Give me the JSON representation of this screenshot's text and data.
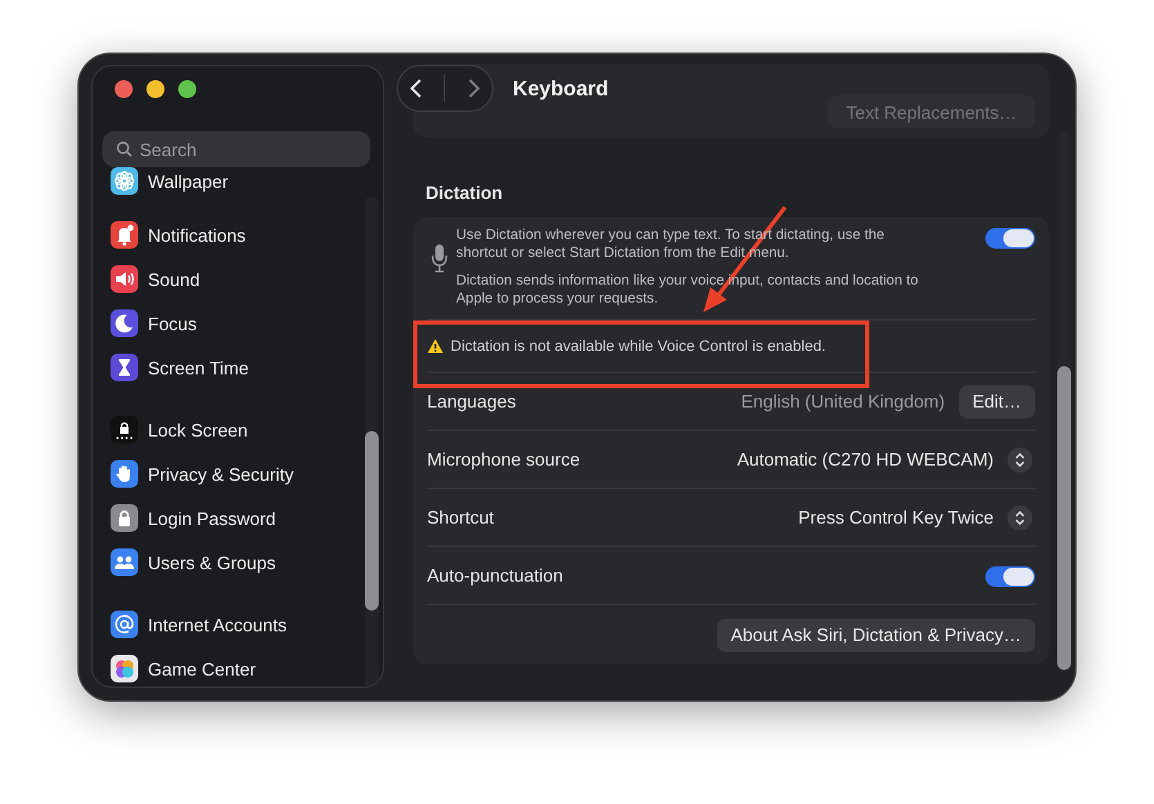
{
  "window": {
    "title": "Keyboard",
    "traffic_lights": [
      {
        "color": "#ec5f58"
      },
      {
        "color": "#f4bf2f"
      },
      {
        "color": "#5fc24a"
      }
    ]
  },
  "sidebar": {
    "search": {
      "placeholder": "Search"
    },
    "groups": [
      {
        "items": [
          {
            "label": "Wallpaper"
          }
        ]
      },
      {
        "items": [
          {
            "label": "Notifications"
          },
          {
            "label": "Sound"
          },
          {
            "label": "Focus"
          },
          {
            "label": "Screen Time"
          }
        ]
      },
      {
        "items": [
          {
            "label": "Lock Screen"
          },
          {
            "label": "Privacy & Security"
          },
          {
            "label": "Login Password"
          },
          {
            "label": "Users & Groups"
          }
        ]
      },
      {
        "items": [
          {
            "label": "Internet Accounts"
          },
          {
            "label": "Game Center"
          }
        ]
      }
    ]
  },
  "top_card": {
    "button": "Text Replacements…"
  },
  "dictation": {
    "heading": "Dictation",
    "description": "Use Dictation wherever you can type text. To start dictating, use the shortcut or select Start Dictation from the Edit menu.",
    "privacy_note": "Dictation sends information like your voice input, contacts and location to Apple to process your requests.",
    "on": true,
    "warning": "Dictation is not available while Voice Control is enabled.",
    "rows": [
      {
        "kind": "value_button",
        "label": "Languages",
        "value": "English (United Kingdom)",
        "button": "Edit…"
      },
      {
        "kind": "popup",
        "label": "Microphone source",
        "value": "Automatic (C270 HD WEBCAM)"
      },
      {
        "kind": "popup",
        "label": "Shortcut",
        "value": "Press Control Key Twice"
      },
      {
        "kind": "toggle",
        "label": "Auto-punctuation",
        "on": true
      }
    ],
    "footer_button": "About Ask Siri, Dictation & Privacy…"
  }
}
